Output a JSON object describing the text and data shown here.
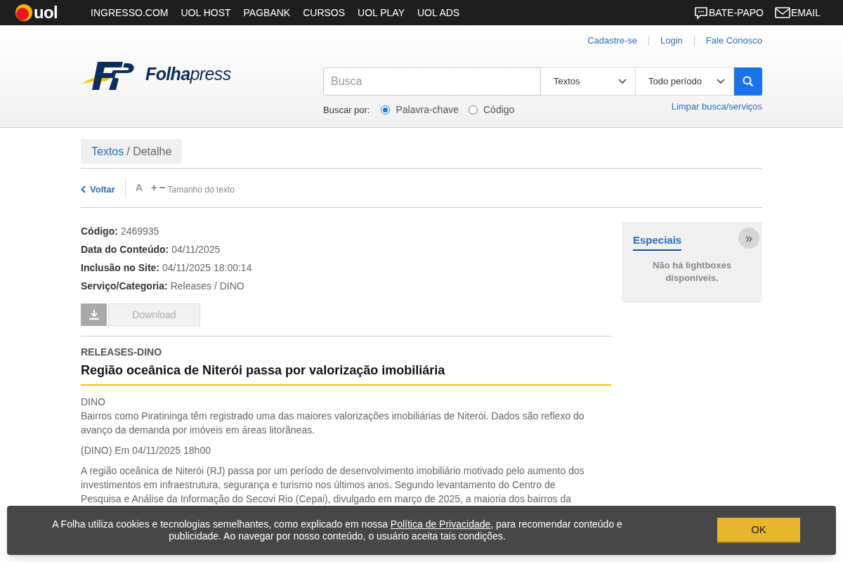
{
  "topbar": {
    "brand": "uol",
    "links": [
      "INGRESSO.COM",
      "UOL HOST",
      "PAGBANK",
      "CURSOS",
      "UOL PLAY",
      "UOL ADS"
    ],
    "right": [
      {
        "kind": "chat",
        "label": "BATE-PAPO"
      },
      {
        "kind": "mail",
        "label": "EMAIL"
      }
    ]
  },
  "header": {
    "links": [
      "Cadastre-se",
      "Login",
      "Fale Conosco"
    ],
    "logo": {
      "bold": "Folha",
      "light": "press"
    },
    "search": {
      "placeholder": "Busca"
    },
    "selects": [
      "Textos",
      "Todo período"
    ],
    "search_by_label": "Buscar por:",
    "radios": [
      {
        "label": "Palavra-chave",
        "selected": true
      },
      {
        "label": "Código",
        "selected": false
      }
    ],
    "clear_link": "Limpar busca/serviços"
  },
  "breadcrumb": {
    "link": "Textos",
    "current": "/ Detalhe"
  },
  "toolbar": {
    "back": "Voltar",
    "font_icon": "A",
    "plus": "+",
    "minus": "−",
    "size_label": "Tamanho do texto"
  },
  "meta": [
    {
      "label": "Código:",
      "value": "2469935"
    },
    {
      "label": "Data do Conteúdo:",
      "value": "04/11/2025"
    },
    {
      "label": "Inclusão no Site:",
      "value": "04/11/2025 18:00:14"
    },
    {
      "label": "Serviço/Categoria:",
      "value": "Releases / DINO"
    }
  ],
  "download": {
    "label": "Download",
    "disabled": true
  },
  "article": {
    "kicker": "RELEASES-DINO",
    "title": "Região oceânica de Niterói passa por valorização imobiliária",
    "byline": "DINO",
    "summary": "Bairros como Piratininga têm registrado uma das maiores valorizações imobiliárias de Niterói. Dados são reflexo do avanço da demanda por imóveis em áreas litorâneas.",
    "dateline": "(DINO) Em 04/11/2025 18h00",
    "paragraph_lines": [
      "A região oceânica de Niterói (RJ) passa por um período de desenvolvimento imobiliário motivado pelo aumento dos",
      "investimentos em infraestrutura, segurança e turismo nos últimos anos. Segundo levantamento do Centro de",
      "Pesquisa e Análise da Informação do Secovi Rio (Cepai), divulgado em março de 2025, a maioria dos bairros da"
    ]
  },
  "sidebar": {
    "title": "Especiais",
    "expand": "»",
    "empty": "Não há lightboxes disponíveis."
  },
  "cookie_banner": {
    "text_before": "A Folha utiliza cookies e tecnologias semelhantes, como explicado em nossa ",
    "link": "Política de Privacidade",
    "text_after": ", para recomendar conteúdo e publicidade. Ao navegar por nosso conteúdo, o usuário aceita tais condições.",
    "button": "OK"
  }
}
